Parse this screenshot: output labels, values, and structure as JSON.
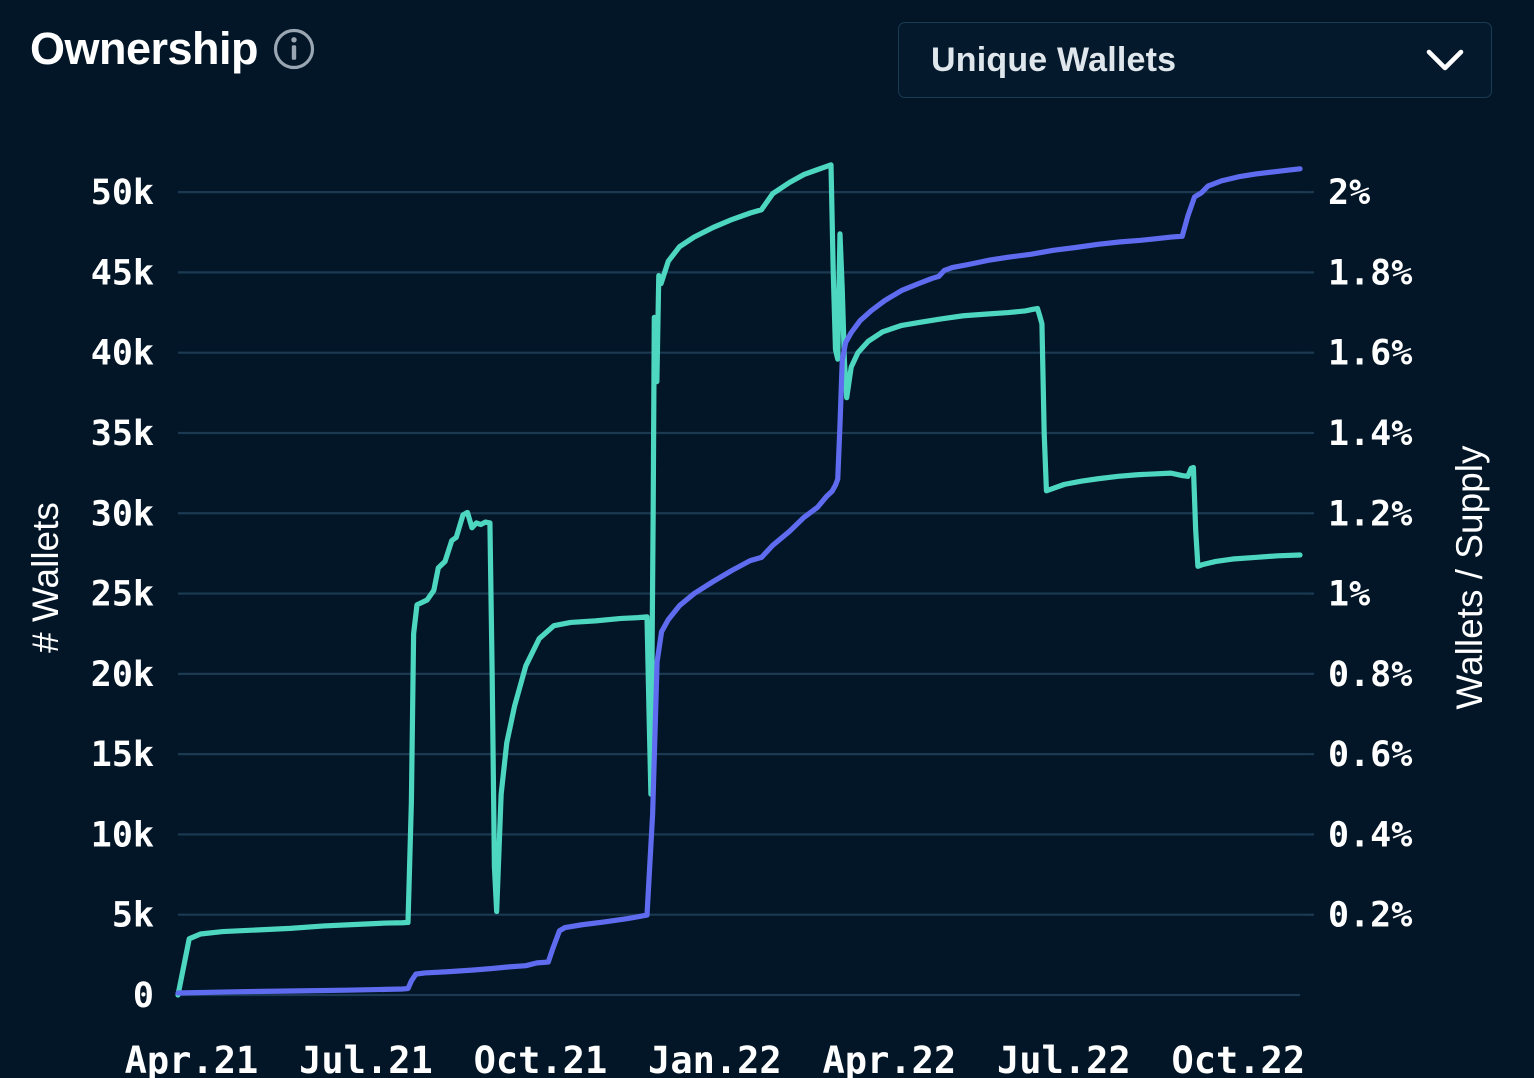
{
  "header": {
    "title": "Ownership",
    "info_icon": "info-circle-icon",
    "metric_selector": {
      "selected": "Unique Wallets",
      "chevron_icon": "chevron-down-icon",
      "options": [
        "Unique Wallets"
      ]
    }
  },
  "colors": {
    "background": "#021627",
    "grid": "#1b3a52",
    "wallets_line": "#4ed7c0",
    "supply_line": "#5f6cf0",
    "text": "#ffffff",
    "select_border": "#1b3b52"
  },
  "chart_data": {
    "type": "line",
    "title": "Ownership",
    "xlabel": "",
    "ylabel": "# Wallets",
    "y2label": "Wallets / Supply",
    "grid": true,
    "legend": "none",
    "x": [
      "Apr.21",
      "Jul.21",
      "Oct.21",
      "Jan.22",
      "Apr.22",
      "Jul.22",
      "Oct.22"
    ],
    "xtick_labels": [
      "Apr.21",
      "Jul.21",
      "Oct.21",
      "Jan.22",
      "Apr.22",
      "Jul.22",
      "Oct.22"
    ],
    "ylim": [
      0,
      52000
    ],
    "ytick_labels": [
      "0",
      "5k",
      "10k",
      "15k",
      "20k",
      "25k",
      "30k",
      "35k",
      "40k",
      "45k",
      "50k"
    ],
    "ytick_values": [
      0,
      5000,
      10000,
      15000,
      20000,
      25000,
      30000,
      35000,
      40000,
      45000,
      50000
    ],
    "y2lim": [
      0,
      2.08
    ],
    "y2tick_labels": [
      "0.2%",
      "0.4%",
      "0.6%",
      "0.8%",
      "1%",
      "1.2%",
      "1.4%",
      "1.6%",
      "1.8%",
      "2%"
    ],
    "y2tick_values": [
      0.2,
      0.4,
      0.6,
      0.8,
      1.0,
      1.2,
      1.4,
      1.6,
      1.8,
      2.0
    ],
    "series": [
      {
        "name": "# Wallets",
        "axis": "left",
        "color": "#4ed7c0",
        "units": "wallets",
        "points": [
          [
            0.0,
            0
          ],
          [
            0.01,
            3500
          ],
          [
            0.02,
            3800
          ],
          [
            0.04,
            3950
          ],
          [
            0.07,
            4050
          ],
          [
            0.1,
            4150
          ],
          [
            0.13,
            4300
          ],
          [
            0.16,
            4400
          ],
          [
            0.185,
            4480
          ],
          [
            0.2,
            4500
          ],
          [
            0.205,
            4520
          ],
          [
            0.208,
            12000
          ],
          [
            0.21,
            22500
          ],
          [
            0.213,
            24300
          ],
          [
            0.222,
            24600
          ],
          [
            0.228,
            25200
          ],
          [
            0.232,
            26600
          ],
          [
            0.238,
            27000
          ],
          [
            0.244,
            28300
          ],
          [
            0.248,
            28500
          ],
          [
            0.254,
            29900
          ],
          [
            0.258,
            30050
          ],
          [
            0.262,
            29100
          ],
          [
            0.266,
            29400
          ],
          [
            0.27,
            29300
          ],
          [
            0.274,
            29450
          ],
          [
            0.278,
            29400
          ],
          [
            0.28,
            20000
          ],
          [
            0.282,
            8000
          ],
          [
            0.284,
            5200
          ],
          [
            0.288,
            12500
          ],
          [
            0.293,
            15700
          ],
          [
            0.3,
            18000
          ],
          [
            0.31,
            20500
          ],
          [
            0.322,
            22200
          ],
          [
            0.335,
            23000
          ],
          [
            0.35,
            23200
          ],
          [
            0.372,
            23300
          ],
          [
            0.395,
            23450
          ],
          [
            0.41,
            23500
          ],
          [
            0.418,
            23550
          ],
          [
            0.42,
            17000
          ],
          [
            0.4215,
            12500
          ],
          [
            0.4235,
            30000
          ],
          [
            0.4245,
            42200
          ],
          [
            0.4255,
            41000
          ],
          [
            0.4268,
            38200
          ],
          [
            0.4285,
            44800
          ],
          [
            0.4305,
            44300
          ],
          [
            0.437,
            45700
          ],
          [
            0.447,
            46600
          ],
          [
            0.46,
            47200
          ],
          [
            0.477,
            47800
          ],
          [
            0.494,
            48300
          ],
          [
            0.51,
            48700
          ],
          [
            0.52,
            48900
          ],
          [
            0.53,
            49900
          ],
          [
            0.545,
            50600
          ],
          [
            0.558,
            51100
          ],
          [
            0.57,
            51400
          ],
          [
            0.578,
            51600
          ],
          [
            0.582,
            51700
          ],
          [
            0.584,
            45000
          ],
          [
            0.586,
            40200
          ],
          [
            0.588,
            39600
          ],
          [
            0.59,
            47400
          ],
          [
            0.592,
            44000
          ],
          [
            0.594,
            39400
          ],
          [
            0.596,
            37200
          ],
          [
            0.6,
            39100
          ],
          [
            0.606,
            40000
          ],
          [
            0.615,
            40700
          ],
          [
            0.628,
            41300
          ],
          [
            0.645,
            41700
          ],
          [
            0.662,
            41900
          ],
          [
            0.68,
            42100
          ],
          [
            0.7,
            42300
          ],
          [
            0.72,
            42400
          ],
          [
            0.74,
            42500
          ],
          [
            0.755,
            42600
          ],
          [
            0.762,
            42700
          ],
          [
            0.766,
            42750
          ],
          [
            0.768,
            42300
          ],
          [
            0.77,
            41800
          ],
          [
            0.772,
            35000
          ],
          [
            0.774,
            31400
          ],
          [
            0.778,
            31500
          ],
          [
            0.79,
            31800
          ],
          [
            0.805,
            32000
          ],
          [
            0.82,
            32150
          ],
          [
            0.838,
            32300
          ],
          [
            0.855,
            32400
          ],
          [
            0.87,
            32450
          ],
          [
            0.885,
            32500
          ],
          [
            0.895,
            32350
          ],
          [
            0.9,
            32300
          ],
          [
            0.903,
            32800
          ],
          [
            0.905,
            32850
          ],
          [
            0.907,
            29000
          ],
          [
            0.909,
            26700
          ],
          [
            0.913,
            26800
          ],
          [
            0.925,
            27000
          ],
          [
            0.94,
            27150
          ],
          [
            0.96,
            27250
          ],
          [
            0.98,
            27350
          ],
          [
            1.0,
            27400
          ]
        ]
      },
      {
        "name": "Wallets / Supply",
        "axis": "right",
        "color": "#5f6cf0",
        "units": "percent",
        "points": [
          [
            0.0,
            0.005
          ],
          [
            0.05,
            0.008
          ],
          [
            0.1,
            0.01
          ],
          [
            0.15,
            0.012
          ],
          [
            0.185,
            0.014
          ],
          [
            0.2,
            0.015
          ],
          [
            0.205,
            0.016
          ],
          [
            0.208,
            0.035
          ],
          [
            0.212,
            0.052
          ],
          [
            0.22,
            0.055
          ],
          [
            0.24,
            0.058
          ],
          [
            0.262,
            0.062
          ],
          [
            0.28,
            0.066
          ],
          [
            0.295,
            0.07
          ],
          [
            0.31,
            0.073
          ],
          [
            0.32,
            0.08
          ],
          [
            0.33,
            0.082
          ],
          [
            0.334,
            0.115
          ],
          [
            0.34,
            0.16
          ],
          [
            0.345,
            0.168
          ],
          [
            0.36,
            0.175
          ],
          [
            0.38,
            0.182
          ],
          [
            0.4,
            0.19
          ],
          [
            0.412,
            0.196
          ],
          [
            0.418,
            0.199
          ],
          [
            0.423,
            0.45
          ],
          [
            0.427,
            0.83
          ],
          [
            0.431,
            0.905
          ],
          [
            0.437,
            0.935
          ],
          [
            0.447,
            0.97
          ],
          [
            0.46,
            1.0
          ],
          [
            0.477,
            1.03
          ],
          [
            0.494,
            1.058
          ],
          [
            0.51,
            1.082
          ],
          [
            0.52,
            1.09
          ],
          [
            0.53,
            1.12
          ],
          [
            0.545,
            1.155
          ],
          [
            0.558,
            1.19
          ],
          [
            0.57,
            1.215
          ],
          [
            0.578,
            1.242
          ],
          [
            0.583,
            1.255
          ],
          [
            0.586,
            1.27
          ],
          [
            0.588,
            1.285
          ],
          [
            0.59,
            1.42
          ],
          [
            0.592,
            1.58
          ],
          [
            0.595,
            1.625
          ],
          [
            0.6,
            1.65
          ],
          [
            0.608,
            1.68
          ],
          [
            0.618,
            1.705
          ],
          [
            0.63,
            1.73
          ],
          [
            0.645,
            1.755
          ],
          [
            0.66,
            1.772
          ],
          [
            0.672,
            1.785
          ],
          [
            0.678,
            1.79
          ],
          [
            0.683,
            1.805
          ],
          [
            0.69,
            1.812
          ],
          [
            0.705,
            1.82
          ],
          [
            0.722,
            1.83
          ],
          [
            0.74,
            1.838
          ],
          [
            0.76,
            1.845
          ],
          [
            0.78,
            1.855
          ],
          [
            0.8,
            1.862
          ],
          [
            0.82,
            1.87
          ],
          [
            0.84,
            1.876
          ],
          [
            0.858,
            1.88
          ],
          [
            0.872,
            1.884
          ],
          [
            0.885,
            1.888
          ],
          [
            0.895,
            1.89
          ],
          [
            0.9,
            1.94
          ],
          [
            0.906,
            1.988
          ],
          [
            0.912,
            1.998
          ],
          [
            0.918,
            2.015
          ],
          [
            0.93,
            2.028
          ],
          [
            0.945,
            2.038
          ],
          [
            0.96,
            2.045
          ],
          [
            0.975,
            2.05
          ],
          [
            0.99,
            2.055
          ],
          [
            1.0,
            2.058
          ]
        ]
      }
    ]
  }
}
